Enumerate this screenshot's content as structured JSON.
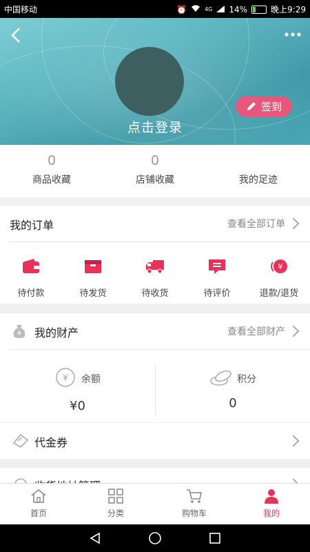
{
  "status_bar": {
    "carrier": "中国移动",
    "network": "4G",
    "battery": "14%",
    "time": "晚上9:29"
  },
  "header": {
    "login_text": "点击登录",
    "signin_label": "签到"
  },
  "stats": [
    {
      "count": "0",
      "label": "商品收藏"
    },
    {
      "count": "0",
      "label": "店铺收藏"
    },
    {
      "label": "我的足迹"
    }
  ],
  "orders": {
    "title": "我的订单",
    "view_all": "查看全部订单",
    "items": [
      {
        "label": "待付款",
        "icon": "wallet-icon"
      },
      {
        "label": "待发货",
        "icon": "box-icon"
      },
      {
        "label": "待收货",
        "icon": "truck-icon"
      },
      {
        "label": "待评价",
        "icon": "comment-icon"
      },
      {
        "label": "退款/退货",
        "icon": "refund-icon"
      }
    ]
  },
  "assets": {
    "title": "我的财产",
    "view_all": "查看全部财产",
    "balance_label": "余额",
    "balance_value": "¥0",
    "points_label": "积分",
    "points_value": "0"
  },
  "voucher": {
    "label": "代金券"
  },
  "address": {
    "label": "收货地址管理"
  },
  "bottom_nav": [
    {
      "label": "首页",
      "icon": "home-icon"
    },
    {
      "label": "分类",
      "icon": "category-icon"
    },
    {
      "label": "购物车",
      "icon": "cart-icon"
    },
    {
      "label": "我的",
      "icon": "user-icon",
      "active": true
    }
  ],
  "colors": {
    "accent": "#e8325a",
    "header_teal": "#4aa6b3",
    "signin_bg": "#e8577a"
  }
}
